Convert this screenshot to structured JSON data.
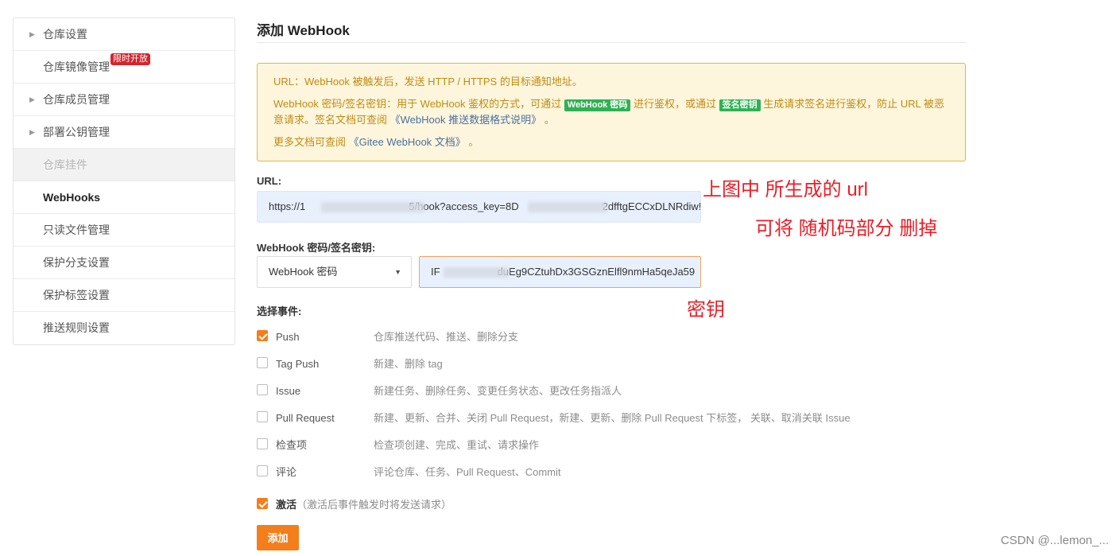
{
  "sidebar": {
    "items": [
      {
        "label": "仓库设置"
      },
      {
        "label": "仓库镜像管理",
        "badge": "限时开放"
      },
      {
        "label": "仓库成员管理"
      },
      {
        "label": "部署公钥管理"
      },
      {
        "label": "仓库挂件"
      },
      {
        "label": "WebHooks"
      },
      {
        "label": "只读文件管理"
      },
      {
        "label": "保护分支设置"
      },
      {
        "label": "保护标签设置"
      },
      {
        "label": "推送规则设置"
      }
    ]
  },
  "page": {
    "title": "添加 WebHook"
  },
  "notice": {
    "line1": "URL：WebHook 被触发后，发送 HTTP / HTTPS 的目标通知地址。",
    "line2_a": "WebHook 密码/签名密钥：用于 WebHook 鉴权的方式，可通过",
    "tag_password": "WebHook 密码",
    "line2_b": "进行鉴权，或通过",
    "tag_sign": "签名密钥",
    "line2_c": "生成请求签名进行鉴权，防止 URL 被恶意请求。签名文档可查阅",
    "doc_link1": "《WebHook 推送数据格式说明》",
    "line2_end": "。",
    "line3_a": "更多文档可查阅",
    "doc_link2": "《Gitee WebHook 文档》",
    "line3_end": "。"
  },
  "url_field": {
    "label": "URL:",
    "value_a": "https://1",
    "value_b": "5/hook?access_key=8D",
    "value_c": "2dfftgECCxDLNRdiw!"
  },
  "auth": {
    "label": "WebHook 密码/签名密钥:",
    "select_value": "WebHook 密码",
    "secret_a": "IF",
    "secret_b": "duEg9CZtuhDx3GSGznElfl9nmHa5qeJa59"
  },
  "events": {
    "label": "选择事件:",
    "items": [
      {
        "name": "Push",
        "desc": "仓库推送代码、推送、删除分支",
        "checked": true
      },
      {
        "name": "Tag Push",
        "desc": "新建、删除 tag",
        "checked": false
      },
      {
        "name": "Issue",
        "desc": "新建任务、删除任务、变更任务状态、更改任务指派人",
        "checked": false
      },
      {
        "name": "Pull Request",
        "desc": "新建、更新、合并、关闭 Pull Request，新建、更新、删除 Pull Request 下标签， 关联、取消关联 Issue",
        "checked": false
      },
      {
        "name": "检查项",
        "desc": "检查项创建、完成、重试、请求操作",
        "checked": false
      },
      {
        "name": "评论",
        "desc": "评论仓库、任务、Pull Request、Commit",
        "checked": false
      }
    ]
  },
  "activate": {
    "label": "激活",
    "hint": "（激活后事件触发时将发送请求）",
    "checked": true
  },
  "submit_label": "添加",
  "annotations": {
    "url_note": "上图中 所生成的 url",
    "random_note": "可将 随机码部分 删掉",
    "key_note": "密钥"
  },
  "watermark": "CSDN @...lemon_..."
}
